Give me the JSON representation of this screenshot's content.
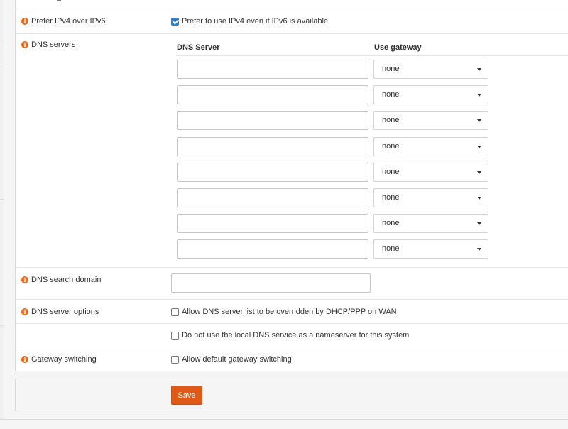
{
  "prefer_ipv4": {
    "label": "Prefer IPv4 over IPv6",
    "checkbox_text": "Prefer to use IPv4 even if IPv6 is available",
    "checked": true
  },
  "dns_servers": {
    "label": "DNS servers",
    "col_server": "DNS Server",
    "col_gateway": "Use gateway",
    "rows": [
      {
        "server": "",
        "gateway": "none"
      },
      {
        "server": "",
        "gateway": "none"
      },
      {
        "server": "",
        "gateway": "none"
      },
      {
        "server": "",
        "gateway": "none"
      },
      {
        "server": "",
        "gateway": "none"
      },
      {
        "server": "",
        "gateway": "none"
      },
      {
        "server": "",
        "gateway": "none"
      },
      {
        "server": "",
        "gateway": "none"
      }
    ]
  },
  "dns_search_domain": {
    "label": "DNS search domain",
    "value": ""
  },
  "dns_server_options": {
    "label": "DNS server options",
    "option1": "Allow DNS server list to be overridden by DHCP/PPP on WAN",
    "option2": "Do not use the local DNS service as a nameserver for this system"
  },
  "gateway_switching": {
    "label": "Gateway switching",
    "checkbox_text": "Allow default gateway switching"
  },
  "actions": {
    "save_label": "Save"
  },
  "colors": {
    "accent": "#e05a17",
    "info_icon": "#e46a1c",
    "checkbox_checked": "#2f7fd6"
  }
}
